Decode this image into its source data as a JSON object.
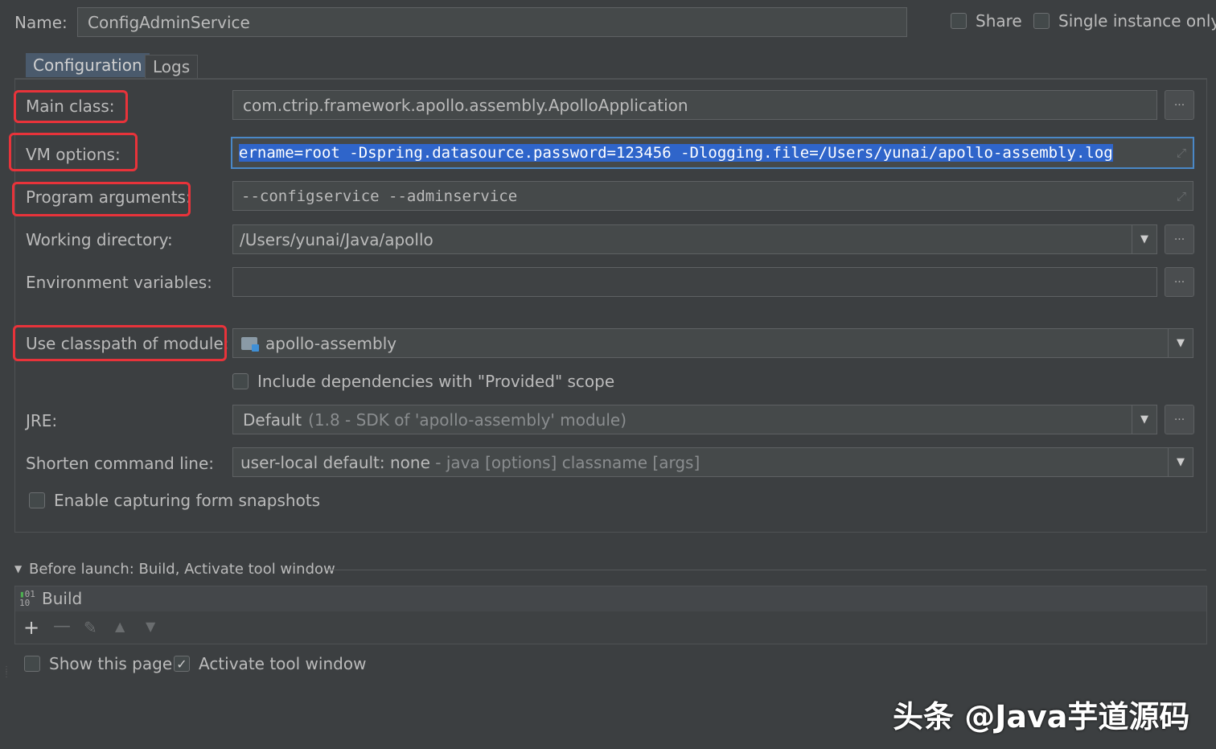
{
  "header": {
    "name_label": "Name:",
    "name_value": "ConfigAdminService",
    "share_label": "Share",
    "single_instance_label": "Single instance only"
  },
  "tabs": [
    {
      "label": "Configuration"
    },
    {
      "label": "Logs"
    }
  ],
  "form": {
    "main_class": {
      "label": "Main class:",
      "value": "com.ctrip.framework.apollo.assembly.ApolloApplication"
    },
    "vm_options": {
      "label": "VM options:",
      "value": "ername=root -Dspring.datasource.password=123456 -Dlogging.file=/Users/yunai/apollo-assembly.log"
    },
    "program_arguments": {
      "label": "Program arguments:",
      "value": "--configservice --adminservice"
    },
    "working_directory": {
      "label": "Working directory:",
      "value": "/Users/yunai/Java/apollo"
    },
    "environment_variables": {
      "label": "Environment variables:",
      "value": ""
    },
    "classpath_module": {
      "label": "Use classpath of module:",
      "value": "apollo-assembly"
    },
    "include_provided": {
      "label": "Include dependencies with \"Provided\" scope"
    },
    "jre": {
      "label": "JRE:",
      "value": "Default",
      "hint": "(1.8 - SDK of 'apollo-assembly' module)"
    },
    "shorten_command_line": {
      "label": "Shorten command line:",
      "value": "user-local default: none",
      "hint": " - java [options] classname [args]"
    },
    "capture_snapshots": {
      "label": "Enable capturing form snapshots"
    },
    "browse_symbol": "···"
  },
  "before_launch": {
    "title": "Before launch: Build, Activate tool window",
    "items": [
      {
        "label": "Build"
      }
    ]
  },
  "footer": {
    "show_page_label": "Show this page",
    "activate_tool_window_label": "Activate tool window",
    "activate_checked": true
  },
  "watermark": "头条 @Java芋道源码",
  "colors": {
    "background": "#3c3f41",
    "field": "#45494a",
    "selection": "#2f65ca",
    "highlight_border": "#e8333a"
  }
}
